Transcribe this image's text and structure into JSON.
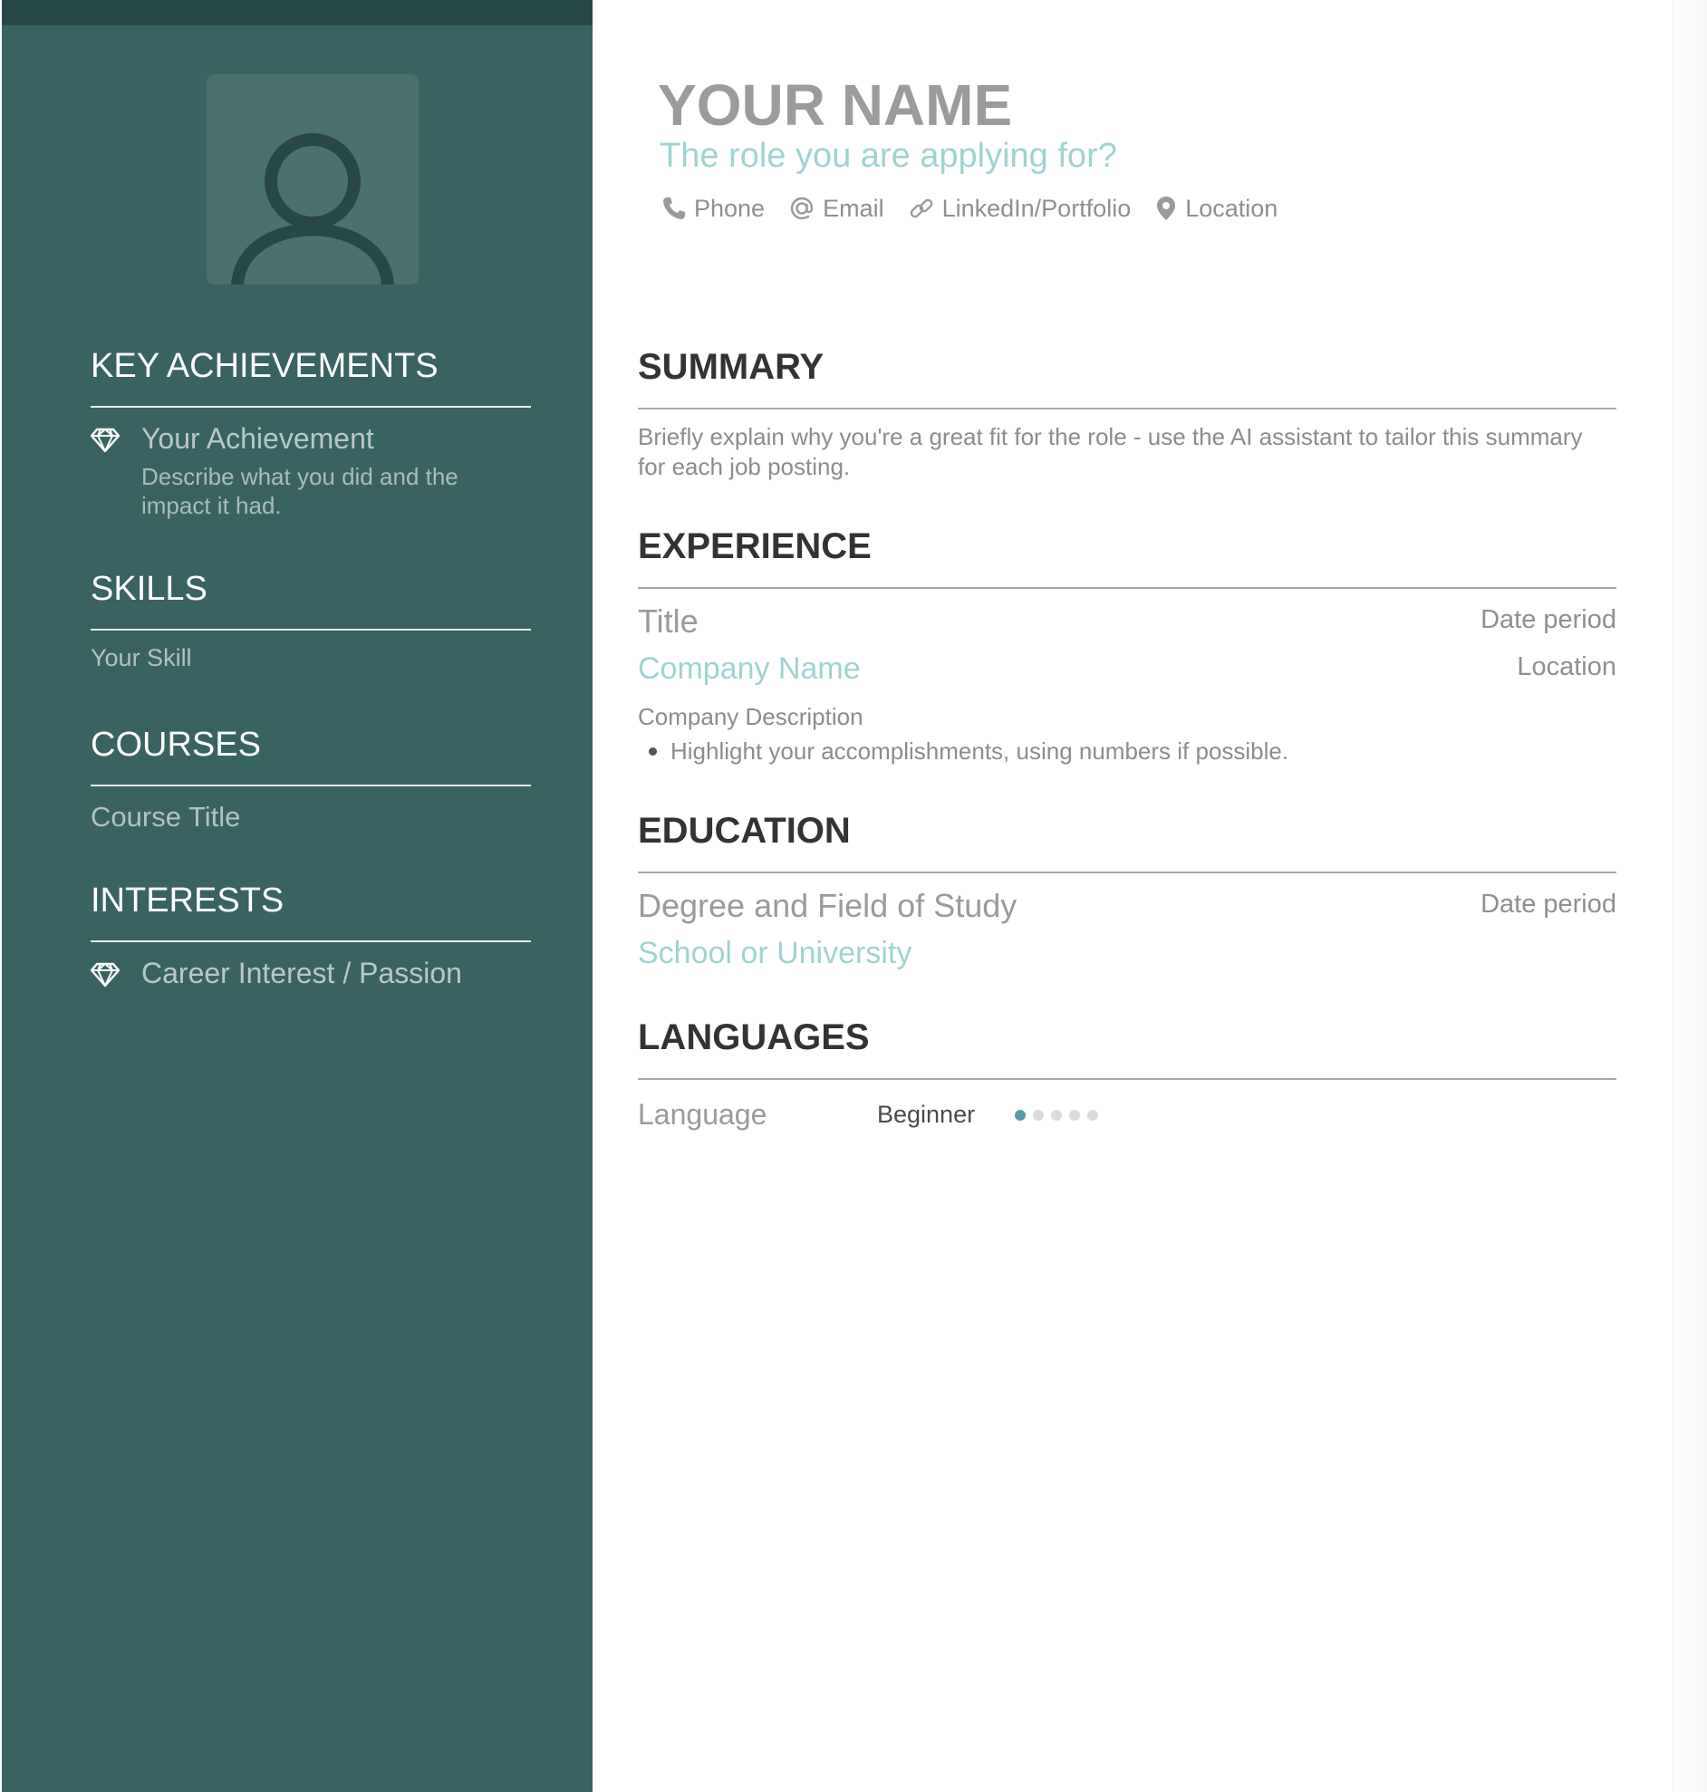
{
  "header": {
    "name": "YOUR NAME",
    "role": "The role you are applying for?",
    "contacts": [
      {
        "icon": "phone-icon",
        "label": "Phone"
      },
      {
        "icon": "at-icon",
        "label": "Email"
      },
      {
        "icon": "link-icon",
        "label": "LinkedIn/Portfolio"
      },
      {
        "icon": "location-pin-icon",
        "label": "Location"
      }
    ]
  },
  "sidebar": {
    "avatar_icon": "person-icon",
    "key_achievements": {
      "heading": "KEY ACHIEVEMENTS",
      "items": [
        {
          "icon": "diamond-icon",
          "title": "Your Achievement",
          "description": "Describe what you did and the impact it had."
        }
      ]
    },
    "skills": {
      "heading": "SKILLS",
      "items": [
        "Your Skill"
      ]
    },
    "courses": {
      "heading": "COURSES",
      "items": [
        "Course Title"
      ]
    },
    "interests": {
      "heading": "INTERESTS",
      "items": [
        {
          "icon": "diamond-icon",
          "label": "Career Interest / Passion"
        }
      ]
    }
  },
  "main": {
    "summary": {
      "heading": "SUMMARY",
      "text": "Briefly explain why you're a great fit for the role - use the AI assistant to tailor this summary for each job posting."
    },
    "experience": {
      "heading": "EXPERIENCE",
      "title": "Title",
      "date": "Date period",
      "company": "Company Name",
      "location": "Location",
      "description": "Company Description",
      "bullets": [
        "Highlight your accomplishments, using numbers if possible."
      ]
    },
    "education": {
      "heading": "EDUCATION",
      "degree": "Degree and Field of Study",
      "date": "Date period",
      "school": "School or University"
    },
    "languages": {
      "heading": "LANGUAGES",
      "items": [
        {
          "name": "Language",
          "level": "Beginner",
          "rating": 1,
          "max": 5
        }
      ]
    }
  },
  "colors": {
    "sidebar": "#386361",
    "sidebar_top": "#274847",
    "accent": "#9fd3d1",
    "rating_on": "#5a9ba7",
    "rating_off": "#dcdcdc"
  }
}
